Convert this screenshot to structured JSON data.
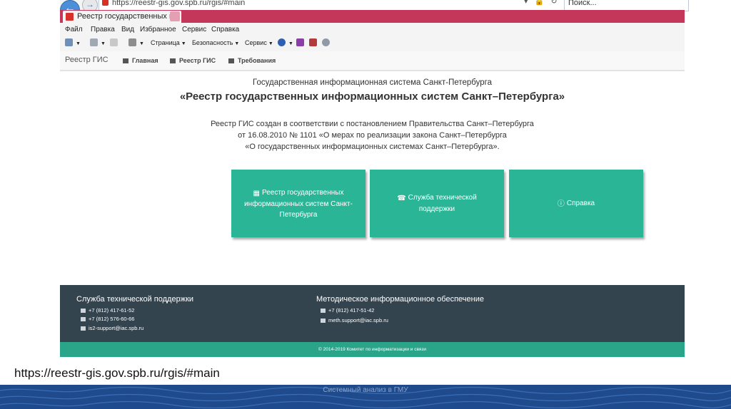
{
  "browser": {
    "address_url": "https://reestr-gis.gov.spb.ru/rgis/#main",
    "search_placeholder": "Поиск...",
    "tab_title": "Реестр государственных и...",
    "menu": [
      "Файл",
      "Правка",
      "Вид",
      "Избранное",
      "Сервис",
      "Справка"
    ],
    "commands": {
      "page": "Страница",
      "security": "Безопасность",
      "service": "Сервис"
    }
  },
  "site_nav": {
    "brand": "Реестр ГИС",
    "links": [
      "Главная",
      "Реестр ГИС",
      "Требования"
    ]
  },
  "main": {
    "subtitle": "Государственная информационная система Санкт-Петербурга",
    "title": "«Реестр государственных информационных систем Санкт–Петербурга»",
    "description": [
      "Реестр ГИС создан в соответствии с постановлением Правительства Санкт–Петербурга",
      "от 16.08.2010 № 1101 «О мерах по реализации закона Санкт–Петербурга",
      "«О государственных информационных системах Санкт–Петербурга»."
    ],
    "tiles": {
      "registry": "Реестр государственных информационных систем Санкт-Петербурга",
      "support": "Служба технической поддержки",
      "help": "Справка"
    }
  },
  "footer": {
    "support": {
      "heading": "Служба технической поддержки",
      "phone1": "+7 (812) 417-61-52",
      "phone2": "+7 (812) 576-60-66",
      "email": "is2-support@iac.spb.ru"
    },
    "methodical": {
      "heading": "Методическое информационное обеспечение",
      "phone": "+7 (812) 417-51-42",
      "email": "meth.support@iac.spb.ru"
    },
    "copyright": "© 2014-2019 Комитет по информатизации и связи"
  },
  "slide": {
    "caption_url": "https://reestr-gis.gov.spb.ru/rgis/#main",
    "footer_text": "Системный анализ в ГМУ"
  },
  "colors": {
    "accent": "#2bb597",
    "footer_bg": "#34444f",
    "footer_bar": "#2aa58a",
    "tab_strip": "#c4365a",
    "slide_strip": "#1f4a8c"
  }
}
